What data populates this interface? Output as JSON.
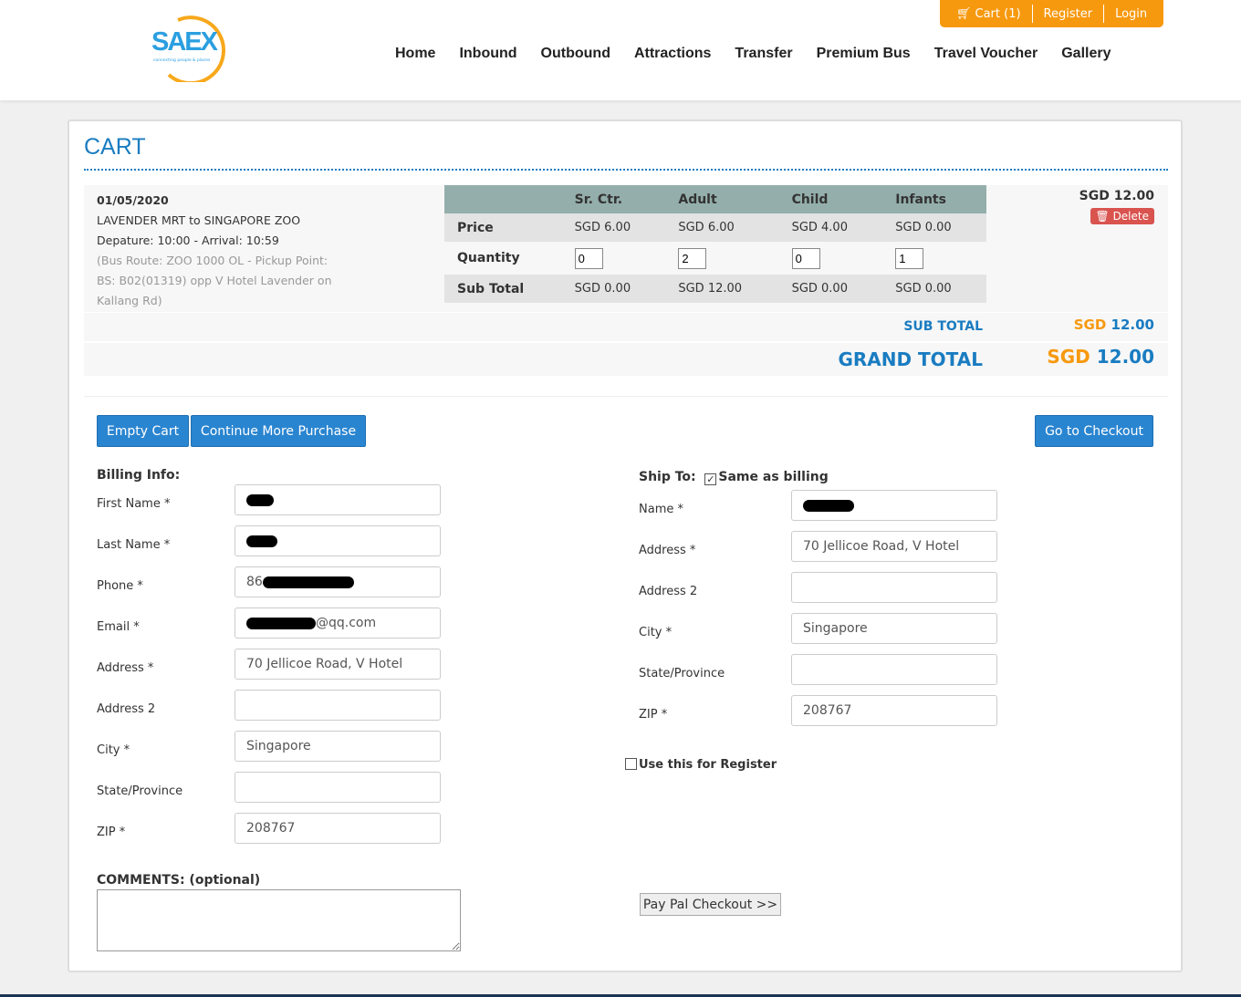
{
  "header": {
    "logo_text": "SAEX",
    "logo_tagline": "connecting people & places",
    "topbar": {
      "cart": "Cart (1)",
      "register": "Register",
      "login": "Login"
    },
    "nav": [
      "Home",
      "Inbound",
      "Outbound",
      "Attractions",
      "Transfer",
      "Premium Bus",
      "Travel Voucher",
      "Gallery"
    ]
  },
  "cart": {
    "title": "CART",
    "item": {
      "date": "01/05/2020",
      "route": "LAVENDER MRT to SINGAPORE ZOO",
      "times": "Depature: 10:00 - Arrival: 10:59",
      "details": "(Bus Route: ZOO 1000 OL - Pickup Point: BS: B02(01319) opp V Hotel Lavender on Kallang Rd)",
      "total": "SGD 12.00",
      "delete": "Delete"
    },
    "table": {
      "headers": [
        "",
        "Sr. Ctr.",
        "Adult",
        "Child",
        "Infants"
      ],
      "price_label": "Price",
      "prices": [
        "SGD 6.00",
        "SGD 6.00",
        "SGD 4.00",
        "SGD 0.00"
      ],
      "quantity_label": "Quantity",
      "quantities": [
        "0",
        "2",
        "0",
        "1"
      ],
      "subtotal_label": "Sub Total",
      "subtotals": [
        "SGD 0.00",
        "SGD 12.00",
        "SGD 0.00",
        "SGD 0.00"
      ]
    },
    "sub_total_label": "SUB TOTAL",
    "sub_total_cur": "SGD",
    "sub_total_val": "12.00",
    "grand_total_label": "GRAND TOTAL",
    "grand_total_cur": "SGD",
    "grand_total_val": "12.00",
    "buttons": {
      "empty": "Empty Cart",
      "continue": "Continue More Purchase",
      "checkout": "Go to Checkout",
      "paypal": "Pay Pal Checkout >>"
    }
  },
  "billing": {
    "title": "Billing Info:",
    "fields": [
      {
        "label": "First Name *",
        "value": ""
      },
      {
        "label": "Last Name *",
        "value": ""
      },
      {
        "label": "Phone *",
        "value": "86"
      },
      {
        "label": "Email *",
        "value": "@qq.com"
      },
      {
        "label": "Address *",
        "value": "70 Jellicoe Road, V Hotel"
      },
      {
        "label": "Address 2",
        "value": ""
      },
      {
        "label": "City *",
        "value": "Singapore"
      },
      {
        "label": "State/Province",
        "value": ""
      },
      {
        "label": "ZIP *",
        "value": "208767"
      }
    ]
  },
  "shipping": {
    "title": "Ship To:",
    "same_as_billing": "Same as billing",
    "same_checked": true,
    "fields": [
      {
        "label": "Name *",
        "value": ""
      },
      {
        "label": "Address *",
        "value": "70 Jellicoe Road, V Hotel"
      },
      {
        "label": "Address 2",
        "value": ""
      },
      {
        "label": "City *",
        "value": "Singapore"
      },
      {
        "label": "State/Province",
        "value": ""
      },
      {
        "label": "ZIP *",
        "value": "208767"
      }
    ],
    "use_for_register": "Use this for Register"
  },
  "comments_label": "COMMENTS: (optional)",
  "colors": {
    "brand_blue": "#1a7cc1",
    "orange": "#f7990f",
    "button_blue": "#2a85d0",
    "delete_red": "#d9534f"
  }
}
